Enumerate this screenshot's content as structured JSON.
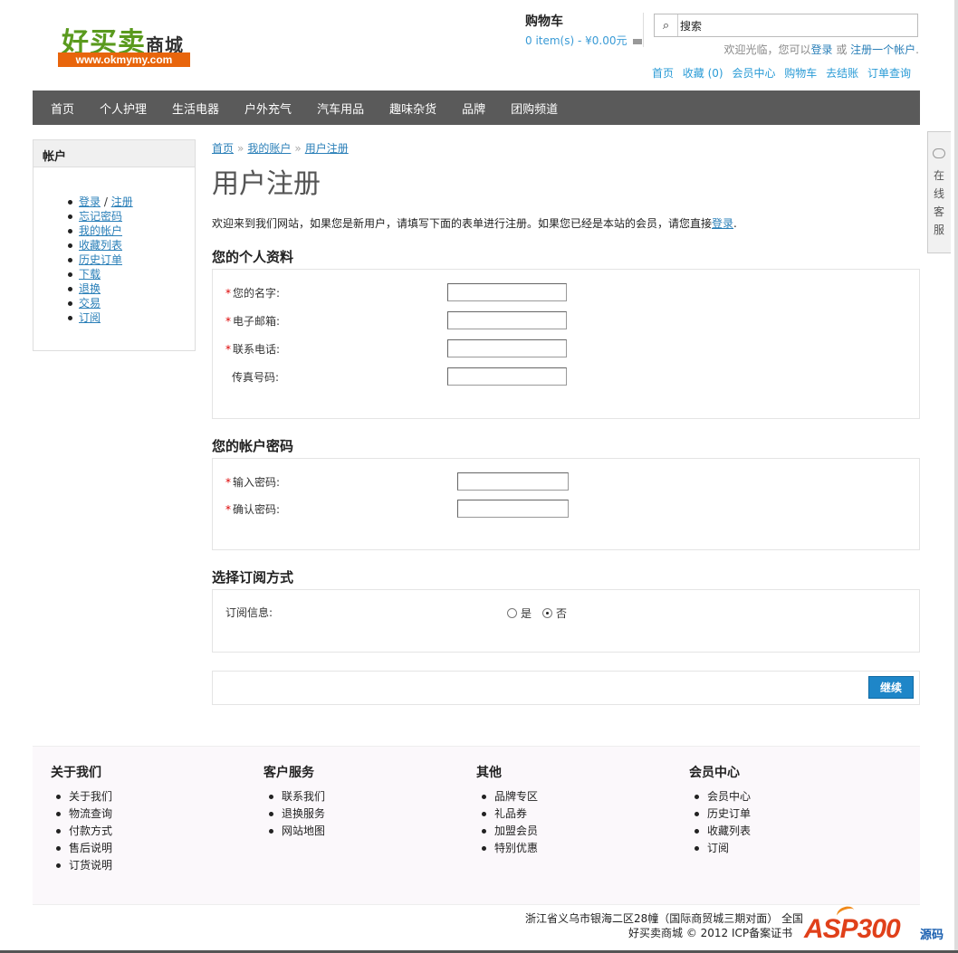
{
  "header": {
    "logo_text": "好买卖",
    "logo_sub": "商城",
    "logo_url": "www.okmymy.com",
    "cart_title": "购物车",
    "cart_summary": "0 item(s) - ¥0.00元",
    "search_placeholder": "搜索",
    "welcome_prefix": "欢迎光临，您可以",
    "welcome_login": "登录",
    "welcome_or": " 或 ",
    "welcome_register": "注册一个帐户",
    "welcome_suffix": ".",
    "toplinks": [
      "首页",
      "收藏 (0)",
      "会员中心",
      "购物车",
      "去结账",
      "订单查询"
    ]
  },
  "nav": {
    "items": [
      "首页",
      "个人护理",
      "生活电器",
      "户外充气",
      "汽车用品",
      "趣味杂货",
      "品牌",
      "团购频道"
    ]
  },
  "sidebar": {
    "title": "帐户",
    "login": "登录",
    "slash": " / ",
    "register": "注册",
    "items": [
      "忘记密码",
      "我的帐户",
      "收藏列表",
      "历史订单",
      "下载",
      "退换",
      "交易",
      "订阅"
    ]
  },
  "main": {
    "breadcrumb": [
      "首页",
      "我的账户",
      "用户注册"
    ],
    "breadcrumb_sep": "»",
    "title": "用户注册",
    "intro": "欢迎来到我们网站，如果您是新用户，请填写下面的表单进行注册。如果您已经是本站的会员，请您直接",
    "intro_link": "登录",
    "intro_end": ".",
    "section_personal": "您的个人资料",
    "label_name": "您的名字:",
    "label_email": "电子邮箱:",
    "label_phone": "联系电话:",
    "label_fax": "传真号码:",
    "section_password": "您的帐户密码",
    "label_password": "输入密码:",
    "label_confirm": "确认密码:",
    "section_newsletter": "选择订阅方式",
    "label_newsletter": "订阅信息:",
    "opt_yes": "是",
    "opt_no": "否",
    "newsletter_selected": "否",
    "continue_label": "继续",
    "required_mark": "*"
  },
  "footer": {
    "columns": [
      {
        "title": "关于我们",
        "items": [
          "关于我们",
          "物流查询",
          "付款方式",
          "售后说明",
          "订货说明"
        ]
      },
      {
        "title": "客户服务",
        "items": [
          "联系我们",
          "退换服务",
          "网站地图"
        ]
      },
      {
        "title": "其他",
        "items": [
          "品牌专区",
          "礼品券",
          "加盟会员",
          "特别优惠"
        ]
      },
      {
        "title": "会员中心",
        "items": [
          "会员中心",
          "历史订单",
          "收藏列表",
          "订阅"
        ]
      }
    ],
    "address": "浙江省义乌市银海二区28幢（国际商贸城三期对面） 全国",
    "copyright": "好买卖商城 © 2012    ICP备案证书"
  },
  "service_tab": {
    "text": "在线客服"
  },
  "watermark": {
    "text": "ASP300",
    "tag": "源码"
  }
}
